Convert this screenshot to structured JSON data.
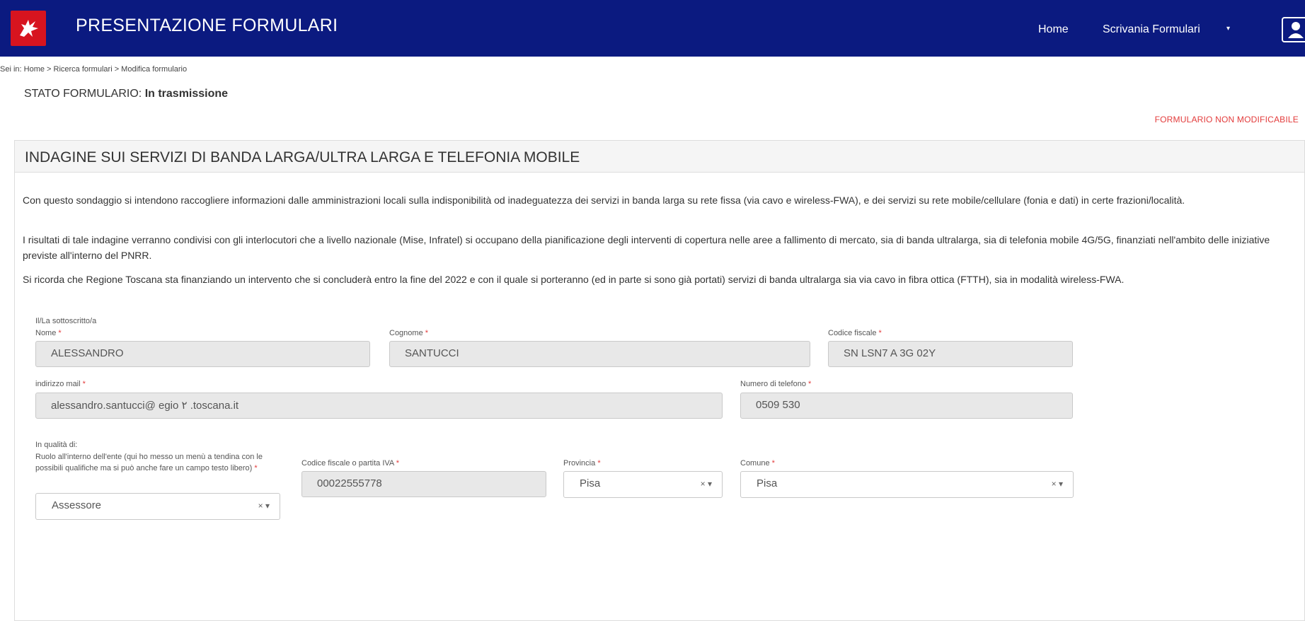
{
  "header": {
    "app_title": "PRESENTAZIONE FORMULARI",
    "nav_home": "Home",
    "nav_scrivania": "Scrivania Formulari",
    "nav_caret": "▾",
    "accent_color": "#0b1a80",
    "logo_color": "#d7141f"
  },
  "breadcrumb": "Sei in: Home > Ricerca formulari > Modifica formulario",
  "status": {
    "label": "STATO FORMULARIO:",
    "value": "In trasmissione",
    "non_editable": "FORMULARIO NON MODIFICABILE"
  },
  "panel": {
    "title": "INDAGINE SUI SERVIZI DI BANDA LARGA/ULTRA LARGA E TELEFONIA MOBILE",
    "paragraphs": [
      "Con questo sondaggio si intendono raccogliere informazioni dalle amministrazioni locali sulla indisponibilità od inadeguatezza dei servizi in banda larga su rete fissa (via cavo e wireless-FWA), e dei servizi su rete mobile/cellulare (fonia e dati) in certe frazioni/località.",
      "I risultati di tale indagine verranno condivisi con gli interlocutori che a livello nazionale (Mise, Infratel) si occupano della pianificazione degli interventi di copertura nelle aree a fallimento di mercato, sia di banda ultralarga, sia di telefonia mobile 4G/5G, finanziati nell'ambito delle iniziative previste all'interno del PNRR.",
      "Si ricorda che Regione Toscana sta finanziando un intervento che si concluderà entro la fine del 2022 e con il quale si porteranno (ed in parte si sono già portati) servizi di banda ultralarga sia via cavo in fibra ottica (FTTH), sia in modalità wireless-FWA."
    ]
  },
  "form": {
    "signer_label": "Il/La sottoscritto/a",
    "required_mark": "*",
    "nome": {
      "label": "Nome",
      "value": "ALESSANDRO"
    },
    "cognome": {
      "label": "Cognome",
      "value": "SANTUCCI"
    },
    "codice_fiscale": {
      "label": "Codice fiscale",
      "value": "SN  LSN7  A  3G  02Y"
    },
    "email": {
      "label": "indirizzo mail",
      "value": "alessandro.santucci@ egio ۲ .toscana.it"
    },
    "telefono": {
      "label": "Numero di telefono",
      "value": "0509  530"
    },
    "qualita_label": "In qualità di:",
    "ruolo": {
      "label": "Ruolo all'interno dell'ente (qui ho messo un menù a tendina con le possibili qualifiche ma si può anche fare un campo testo libero)",
      "value": "Assessore"
    },
    "cf_piva": {
      "label": "Codice fiscale o partita IVA",
      "value": "00022555778"
    },
    "provincia": {
      "label": "Provincia",
      "value": "Pisa"
    },
    "comune": {
      "label": "Comune",
      "value": "Pisa"
    },
    "select_controls": "× ▾"
  }
}
